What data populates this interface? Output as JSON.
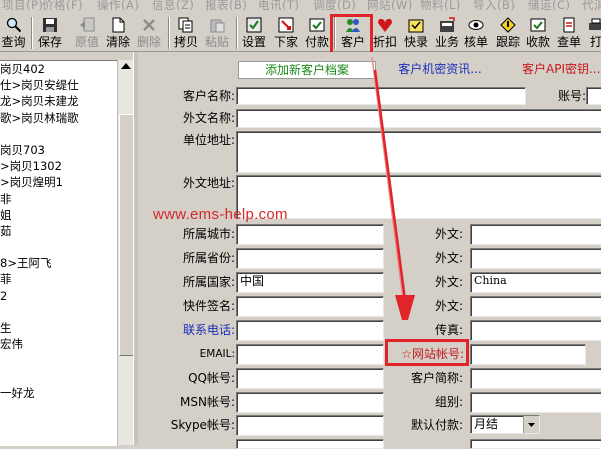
{
  "menubar": [
    "项目(P)",
    "价格(F)",
    "操作(A)",
    "信息(Z)",
    "报表(B)",
    "电讯(T)",
    "调度(D)",
    "网站(W)",
    "物料(L)",
    "导入(B)",
    "储运(C)",
    "代消"
  ],
  "toolbar": {
    "buttons": [
      {
        "label": "查询",
        "icon": "search-icon"
      },
      {
        "label": "保存",
        "icon": "save-icon"
      },
      {
        "label": "原值",
        "icon": "undo-icon"
      },
      {
        "label": "清除",
        "icon": "clear-icon"
      },
      {
        "label": "删除",
        "icon": "delete-icon"
      },
      {
        "label": "拷贝",
        "icon": "copy-icon"
      },
      {
        "label": "粘贴",
        "icon": "paste-icon"
      },
      {
        "label": "设置",
        "icon": "settings-icon"
      },
      {
        "label": "下家",
        "icon": "next-icon"
      },
      {
        "label": "付款",
        "icon": "payment-icon"
      },
      {
        "label": "客户",
        "icon": "customer-icon"
      },
      {
        "label": "折扣",
        "icon": "discount-icon"
      },
      {
        "label": "快录",
        "icon": "quick-entry-icon"
      },
      {
        "label": "业务",
        "icon": "business-icon"
      },
      {
        "label": "核单",
        "icon": "verify-icon"
      },
      {
        "label": "跟踪",
        "icon": "track-icon"
      },
      {
        "label": "收款",
        "icon": "receive-icon"
      },
      {
        "label": "查单",
        "icon": "find-order-icon"
      },
      {
        "label": "打",
        "icon": "print-icon"
      }
    ]
  },
  "list": [
    "岗贝402",
    "仕>岗贝安缇仕",
    "龙>岗贝未建龙",
    "歌>岗贝林瑞歌",
    "",
    "岗贝703",
    ">岗贝1302",
    ">岗贝煌明1",
    "非",
    "姐",
    "茹",
    "",
    "8>王阿飞",
    "菲",
    "2",
    "",
    "生",
    "宏伟",
    "",
    "",
    "一好龙",
    ""
  ],
  "tabs": {
    "add_new": "添加新客户档案",
    "secret": "客户机密资讯...",
    "api": "客户API密钥..."
  },
  "form": {
    "customer_name_label": "客户名称:",
    "account_no_label": "账号:",
    "foreign_name_label": "外文名称:",
    "unit_address_label": "单位地址:",
    "foreign_address_label": "外文地址:",
    "city_label": "所属城市:",
    "province_label": "所属省份:",
    "country_label": "所属国家:",
    "country_value": "中国",
    "express_sign_label": "快件签名:",
    "phone_label": "联系电话:",
    "email_label": "EMAIL:",
    "qq_label": "QQ帐号:",
    "msn_label": "MSN帐号:",
    "skype_label": "Skype帐号:",
    "foreign1_label": "外文:",
    "foreign2_label": "外文:",
    "foreign3_label": "外文:",
    "foreign3_value": "China",
    "foreign4_label": "外文:",
    "fax_label": "传真:",
    "website_account_label": "☆网站帐号:",
    "customer_abbr_label": "客户简称:",
    "group_label": "组别:",
    "default_payment_label": "默认付款:",
    "default_payment_value": "月结"
  },
  "watermark": "www.ems-help.com",
  "colors": {
    "highlight": "#e0242a",
    "link_blue": "#1a2fb8",
    "link_green": "#1b8a1b",
    "link_red": "#c8181c"
  }
}
